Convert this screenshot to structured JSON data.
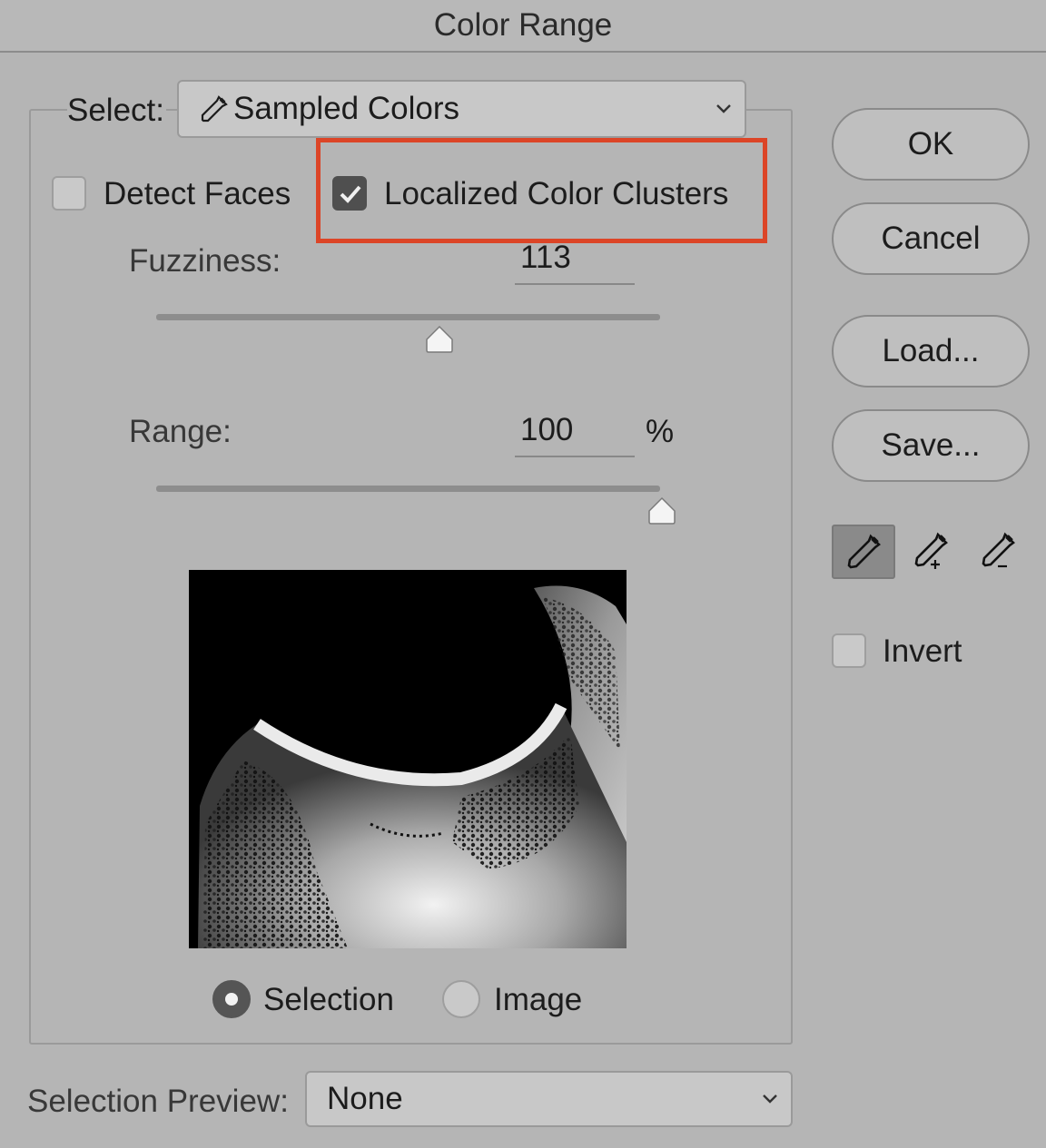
{
  "window": {
    "title": "Color Range"
  },
  "select": {
    "label": "Select:",
    "value": "Sampled Colors",
    "icon": "eyedropper-icon"
  },
  "options": {
    "detect_faces": {
      "label": "Detect Faces",
      "checked": false
    },
    "localized_color_clusters": {
      "label": "Localized Color Clusters",
      "checked": true
    }
  },
  "fuzziness": {
    "label": "Fuzziness:",
    "value": "113",
    "slider_fraction": 0.56
  },
  "range": {
    "label": "Range:",
    "value": "100",
    "unit": "%",
    "slider_fraction": 1.0
  },
  "view_mode": {
    "selection_label": "Selection",
    "image_label": "Image",
    "selected": "selection"
  },
  "selection_preview": {
    "label": "Selection Preview:",
    "value": "None"
  },
  "buttons": {
    "ok": "OK",
    "cancel": "Cancel",
    "load": "Load...",
    "save": "Save..."
  },
  "tools": [
    "eyedropper-icon",
    "eyedropper-plus-icon",
    "eyedropper-minus-icon"
  ],
  "invert": {
    "label": "Invert",
    "checked": false
  },
  "colors": {
    "highlight": "#dc4527",
    "background": "#b5b5b5"
  }
}
